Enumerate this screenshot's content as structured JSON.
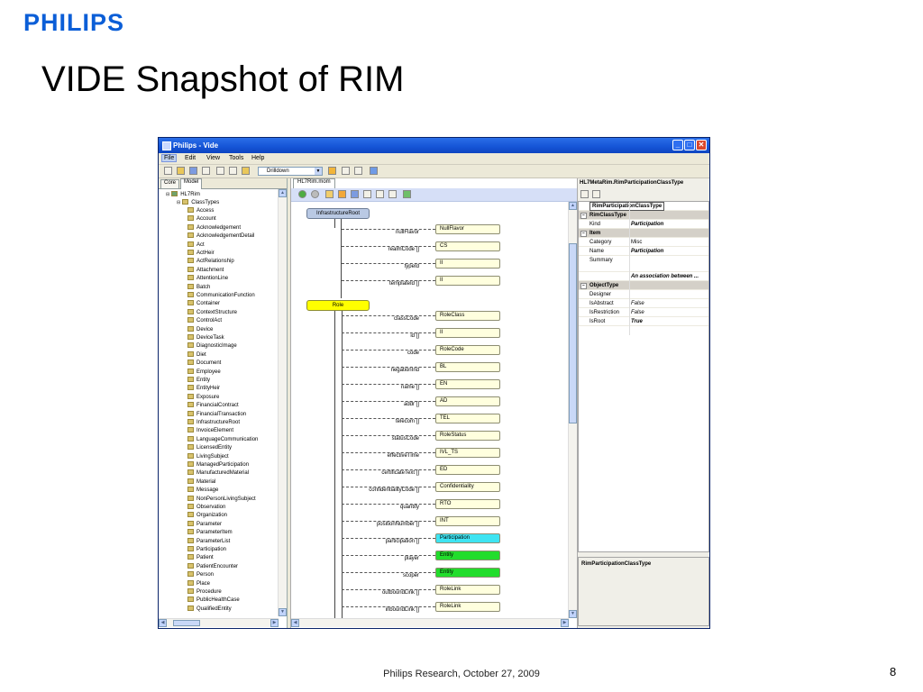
{
  "slide": {
    "logo": "PHILIPS",
    "title": "VIDE Snapshot of RIM",
    "footer": "Philips Research, October 27, 2009",
    "page_number": "8"
  },
  "window": {
    "title": "Philips - Vide",
    "controls": {
      "minimize": "_",
      "maximize": "□",
      "close": "✕"
    },
    "menu": [
      "File",
      "Edit",
      "View",
      "Tools",
      "Help"
    ],
    "toolbar": {
      "combo_value": "Drilldown"
    }
  },
  "left_panel": {
    "tabs": [
      "Core",
      "Model"
    ],
    "tree_root": "HL7Rim",
    "tree_group": "ClassTypes",
    "items": [
      "Access",
      "Account",
      "Acknowledgement",
      "AcknowledgementDetail",
      "Act",
      "ActHeir",
      "ActRelationship",
      "Attachment",
      "AttentionLine",
      "Batch",
      "CommunicationFunction",
      "Container",
      "ContextStructure",
      "ControlAct",
      "Device",
      "DeviceTask",
      "DiagnosticImage",
      "Diet",
      "Document",
      "Employee",
      "Entity",
      "EntityHeir",
      "Exposure",
      "FinancialContract",
      "FinancialTransaction",
      "InfrastructureRoot",
      "InvoiceElement",
      "LanguageCommunication",
      "LicensedEntity",
      "LivingSubject",
      "ManagedParticipation",
      "ManufacturedMaterial",
      "Material",
      "Message",
      "NonPersonLivingSubject",
      "Observation",
      "Organization",
      "Parameter",
      "ParameterItem",
      "ParameterList",
      "Participation",
      "Patient",
      "PatientEncounter",
      "Person",
      "Place",
      "Procedure",
      "PublicHealthCase",
      "QualifiedEntity"
    ]
  },
  "middle_panel": {
    "tab": "HL7Rim.mom",
    "infra_root": "InfrastructureRoot",
    "infra_attrs": [
      {
        "name": "nullFlavor",
        "type": "NullFlavor",
        "color": "default"
      },
      {
        "name": "realmCode []",
        "type": "CS",
        "color": "default"
      },
      {
        "name": "typeId",
        "type": "II",
        "color": "default"
      },
      {
        "name": "templateId []",
        "type": "II",
        "color": "default"
      }
    ],
    "role": "Role",
    "role_attrs": [
      {
        "name": "classCode",
        "type": "RoleClass",
        "color": "default"
      },
      {
        "name": "id []",
        "type": "II",
        "color": "default"
      },
      {
        "name": "code",
        "type": "RoleCode",
        "color": "default"
      },
      {
        "name": "negationInd",
        "type": "BL",
        "color": "default"
      },
      {
        "name": "name []",
        "type": "EN",
        "color": "default"
      },
      {
        "name": "addr []",
        "type": "AD",
        "color": "default"
      },
      {
        "name": "telecom []",
        "type": "TEL",
        "color": "default"
      },
      {
        "name": "statusCode",
        "type": "RoleStatus",
        "color": "default"
      },
      {
        "name": "effectiveTime",
        "type": "IVL_TS",
        "color": "default"
      },
      {
        "name": "certificateText []",
        "type": "ED",
        "color": "default"
      },
      {
        "name": "confidentialityCode []",
        "type": "Confidentiality",
        "color": "default"
      },
      {
        "name": "quantity",
        "type": "RTO",
        "color": "default"
      },
      {
        "name": "positionNumber []",
        "type": "INT",
        "color": "default"
      },
      {
        "name": "participation []",
        "type": "Participation",
        "color": "cyan"
      },
      {
        "name": "player",
        "type": "Entity",
        "color": "green"
      },
      {
        "name": "scoper",
        "type": "Entity",
        "color": "green"
      },
      {
        "name": "outboundLink []",
        "type": "RoleLink",
        "color": "default"
      },
      {
        "name": "inboundLink []",
        "type": "RoleLink",
        "color": "default"
      }
    ]
  },
  "right_panel": {
    "title": "HL7MetaRim.RimParticipationClassType",
    "rows": [
      {
        "kind": "header",
        "key": "RimParticipationClassType"
      },
      {
        "kind": "cat",
        "key": "RimClassType"
      },
      {
        "kind": "row",
        "key": "Kind",
        "value": "Participation",
        "style": "bi"
      },
      {
        "kind": "cat",
        "key": "Item"
      },
      {
        "kind": "row",
        "key": "Category",
        "value": "Misc",
        "style": "n"
      },
      {
        "kind": "row",
        "key": "Name",
        "value": "Participation",
        "style": "bi"
      },
      {
        "kind": "row",
        "key": "Summary",
        "value": "",
        "style": "n"
      },
      {
        "kind": "row",
        "key": "",
        "value": "An association between ...",
        "style": "bi"
      },
      {
        "kind": "cat",
        "key": "ObjectType"
      },
      {
        "kind": "row",
        "key": "Designer",
        "value": "",
        "style": "n"
      },
      {
        "kind": "row",
        "key": "IsAbstract",
        "value": "False",
        "style": "i"
      },
      {
        "kind": "row",
        "key": "IsRestriction",
        "value": "False",
        "style": "i"
      },
      {
        "kind": "row",
        "key": "IsRoot",
        "value": "True",
        "style": "bi"
      }
    ],
    "description_title": "RimParticipationClassType"
  }
}
